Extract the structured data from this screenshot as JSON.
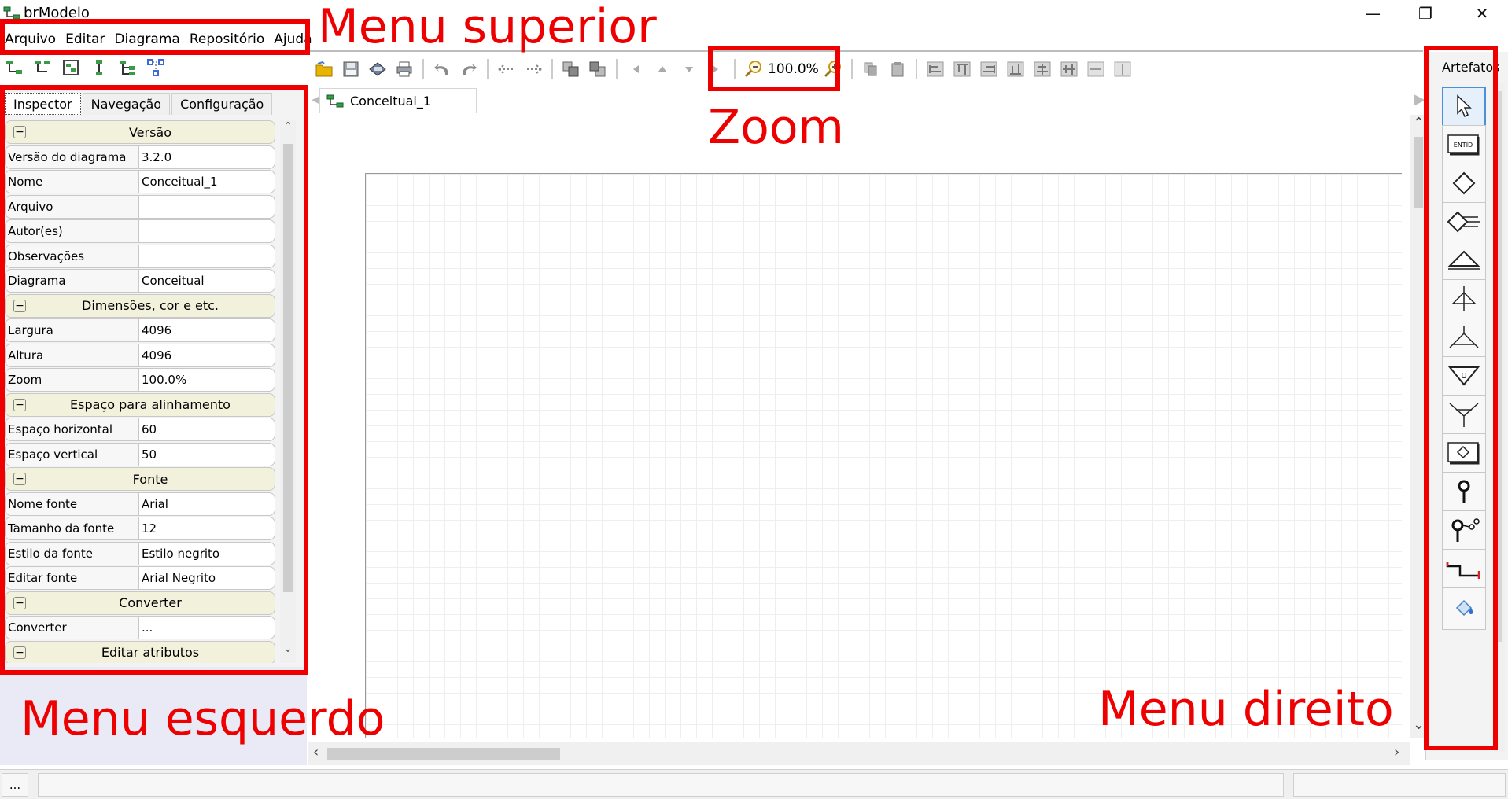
{
  "window": {
    "title": "brModelo",
    "minimize": "—",
    "maximize": "❐",
    "close": "✕"
  },
  "menu": [
    "Arquivo",
    "Editar",
    "Diagrama",
    "Repositório",
    "Ajuda"
  ],
  "left_tabs": [
    "Inspector",
    "Navegação",
    "Configuração"
  ],
  "inspector": {
    "rows": [
      {
        "type": "group",
        "label": "Versão"
      },
      {
        "type": "prop",
        "key": "Versão do diagrama",
        "value": "3.2.0"
      },
      {
        "type": "prop",
        "key": "Nome",
        "value": "Conceitual_1"
      },
      {
        "type": "prop",
        "key": "Arquivo",
        "value": ""
      },
      {
        "type": "prop",
        "key": "Autor(es)",
        "value": ""
      },
      {
        "type": "prop",
        "key": "Observações",
        "value": ""
      },
      {
        "type": "prop",
        "key": "Diagrama",
        "value": "Conceitual"
      },
      {
        "type": "group",
        "label": "Dimensões, cor e etc."
      },
      {
        "type": "prop",
        "key": "Largura",
        "value": "4096"
      },
      {
        "type": "prop",
        "key": "Altura",
        "value": "4096"
      },
      {
        "type": "prop",
        "key": "Zoom",
        "value": "100.0%"
      },
      {
        "type": "group",
        "label": "Espaço para alinhamento"
      },
      {
        "type": "prop",
        "key": "Espaço horizontal",
        "value": "60"
      },
      {
        "type": "prop",
        "key": "Espaço vertical",
        "value": "50"
      },
      {
        "type": "group",
        "label": "Fonte"
      },
      {
        "type": "prop",
        "key": "Nome fonte",
        "value": "Arial"
      },
      {
        "type": "prop",
        "key": "Tamanho da fonte",
        "value": "12"
      },
      {
        "type": "prop",
        "key": "Estilo da fonte",
        "value": "Estilo negrito"
      },
      {
        "type": "prop",
        "key": "Editar fonte",
        "value": "Arial Negrito"
      },
      {
        "type": "group",
        "label": "Converter"
      },
      {
        "type": "prop",
        "key": "Converter",
        "value": "..."
      },
      {
        "type": "group",
        "label": "Editar atributos"
      }
    ]
  },
  "toolbar": {
    "zoom": "100.0%"
  },
  "document_tab": "Conceitual_1",
  "palette": {
    "title": "Artefatos",
    "items": [
      "pointer-icon",
      "entity-icon",
      "relationship-icon",
      "self-relationship-icon",
      "specialization-icon",
      "exclusive-specialization-icon",
      "optional-specialization-icon",
      "union-icon",
      "multiple-union-icon",
      "associative-entity-icon",
      "attribute-icon",
      "composite-attribute-icon",
      "link-icon",
      "fill-color-icon"
    ]
  },
  "status": {
    "dots": "..."
  },
  "annotations": {
    "menu_superior": "Menu superior",
    "zoom": "Zoom",
    "menu_esquerdo": "Menu esquerdo",
    "menu_direito": "Menu direito",
    "color": "#ee0000"
  }
}
